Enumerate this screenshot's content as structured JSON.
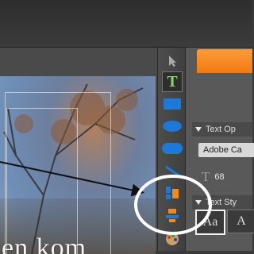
{
  "canvas": {
    "overlay_text": "en kom"
  },
  "toolbox": {
    "tools": [
      {
        "icon": "arrow-select-icon"
      },
      {
        "icon": "text-tool-icon",
        "glyph": "T"
      },
      {
        "icon": "rectangle-icon"
      },
      {
        "icon": "ellipse-icon"
      },
      {
        "icon": "rounded-rectangle-icon"
      },
      {
        "icon": "line-icon"
      },
      {
        "icon": "align-left-icon"
      },
      {
        "icon": "align-center-icon"
      },
      {
        "icon": "color-wheel-icon"
      }
    ]
  },
  "panel": {
    "text_options": {
      "label": "Text Op"
    },
    "font_family": {
      "value": "Adobe Ca"
    },
    "font_size": {
      "glyph": "T",
      "value": "68"
    },
    "text_styles": {
      "label": "Text Sty"
    },
    "style_swatches": [
      "Aa",
      "A"
    ]
  },
  "colors": {
    "accent": "#f07a10",
    "callout": "#ffffff"
  }
}
